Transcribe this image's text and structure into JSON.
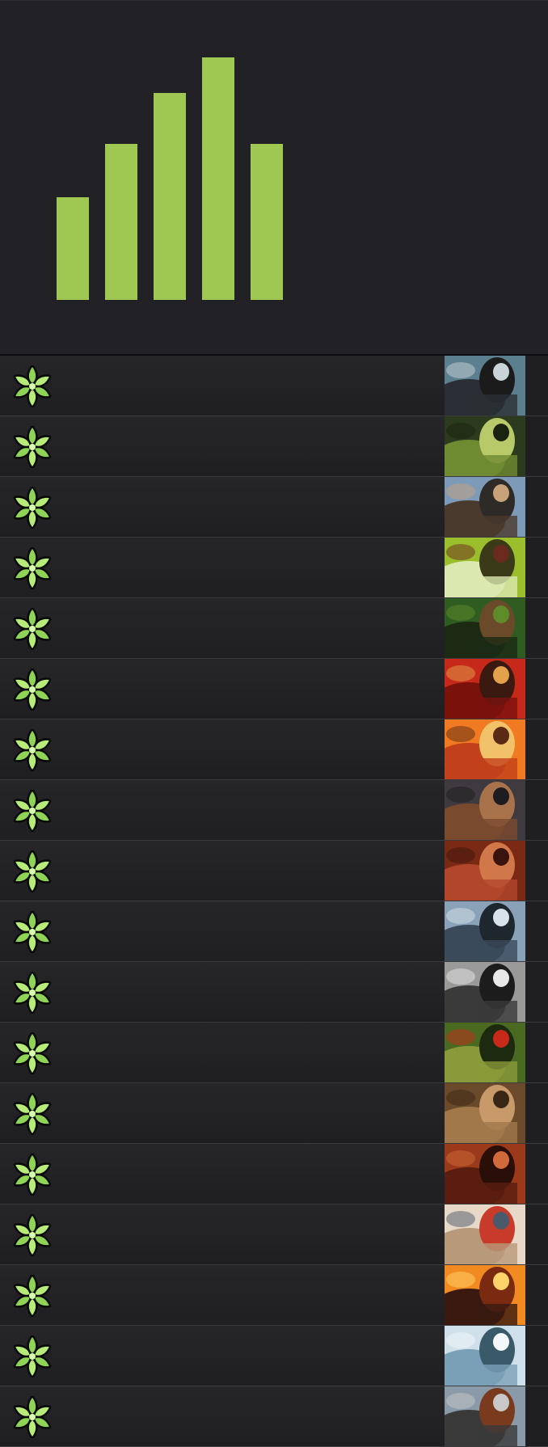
{
  "colors": {
    "background": "#1e1e21",
    "panel": "#222226",
    "bar": "#9fc853",
    "row_divider": "#3a3a3f",
    "icon_fill": "#8fd457",
    "icon_outline": "#0a0a0a"
  },
  "chart_data": {
    "type": "bar",
    "categories": [
      "",
      "",
      "",
      "",
      ""
    ],
    "values": [
      127,
      193,
      256,
      300,
      193
    ],
    "title": "",
    "xlabel": "",
    "ylabel": "",
    "ylim": [
      0,
      300
    ],
    "grid": false,
    "legend": "none"
  },
  "list": {
    "row_icon": "green-flower-sigil-icon",
    "items": [
      {
        "thumb": "hooded-rider-with-wolf-art",
        "palette": [
          "#5b7f8e",
          "#2b2f35",
          "#c9d4d8",
          "#1b1b1b"
        ]
      },
      {
        "thumb": "forest-beast-art",
        "palette": [
          "#2c3a1d",
          "#6f8b32",
          "#1a2210",
          "#b8c96a"
        ]
      },
      {
        "thumb": "bearded-warrior-sword-art",
        "palette": [
          "#7d9bb8",
          "#4a3a2d",
          "#c9a27a",
          "#2e2a27"
        ]
      },
      {
        "thumb": "red-hooded-archer-stag-art",
        "palette": [
          "#9bbf2c",
          "#dbe9b0",
          "#6b2a1e",
          "#3a3a18"
        ]
      },
      {
        "thumb": "jungle-hunter-art",
        "palette": [
          "#2f5c21",
          "#1c2a14",
          "#5f8c2a",
          "#6b4a2a"
        ]
      },
      {
        "thumb": "fire-boar-rider-art",
        "palette": [
          "#c6281a",
          "#7a120c",
          "#e2a14a",
          "#3a1a10"
        ]
      },
      {
        "thumb": "warrior-sunset-cliff-art",
        "palette": [
          "#f07a22",
          "#c2401a",
          "#5a2a14",
          "#f2c26a"
        ]
      },
      {
        "thumb": "armored-brawler-art",
        "palette": [
          "#3e3a3f",
          "#7a4a2e",
          "#1e1c20",
          "#a8724a"
        ]
      },
      {
        "thumb": "red-ogre-art",
        "palette": [
          "#7a2a14",
          "#b2462a",
          "#3a140c",
          "#d0784a"
        ]
      },
      {
        "thumb": "steel-golem-art",
        "palette": [
          "#8aa2b8",
          "#3a4a5a",
          "#d8e2ea",
          "#1e262e"
        ]
      },
      {
        "thumb": "white-beast-skull-art",
        "palette": [
          "#9a9a9a",
          "#3a3a3a",
          "#e8e8e8",
          "#1c1c1c"
        ]
      },
      {
        "thumb": "goblin-spear-art",
        "palette": [
          "#4a6a22",
          "#8a9a3a",
          "#c82a1a",
          "#1e2a10"
        ]
      },
      {
        "thumb": "bear-brute-art",
        "palette": [
          "#6a4a2a",
          "#a0784a",
          "#3a2614",
          "#c89a6a"
        ]
      },
      {
        "thumb": "hooded-red-giant-art",
        "palette": [
          "#9a3a1a",
          "#5a1e10",
          "#d06a3a",
          "#2a0e08"
        ]
      },
      {
        "thumb": "screaming-barbarian-art",
        "palette": [
          "#e8d8c8",
          "#b89a7a",
          "#4a5a6a",
          "#c83a2a"
        ]
      },
      {
        "thumb": "lava-field-art",
        "palette": [
          "#f28a22",
          "#3a1a10",
          "#ffd36a",
          "#7a2a10"
        ]
      },
      {
        "thumb": "white-wolf-art",
        "palette": [
          "#cfe0ea",
          "#7aa0b8",
          "#f4f8fa",
          "#3a5a6a"
        ]
      },
      {
        "thumb": "horned-helm-warrior-art",
        "palette": [
          "#8a9aa8",
          "#3a3a3a",
          "#c8c8c8",
          "#7a3a1e"
        ]
      }
    ]
  }
}
